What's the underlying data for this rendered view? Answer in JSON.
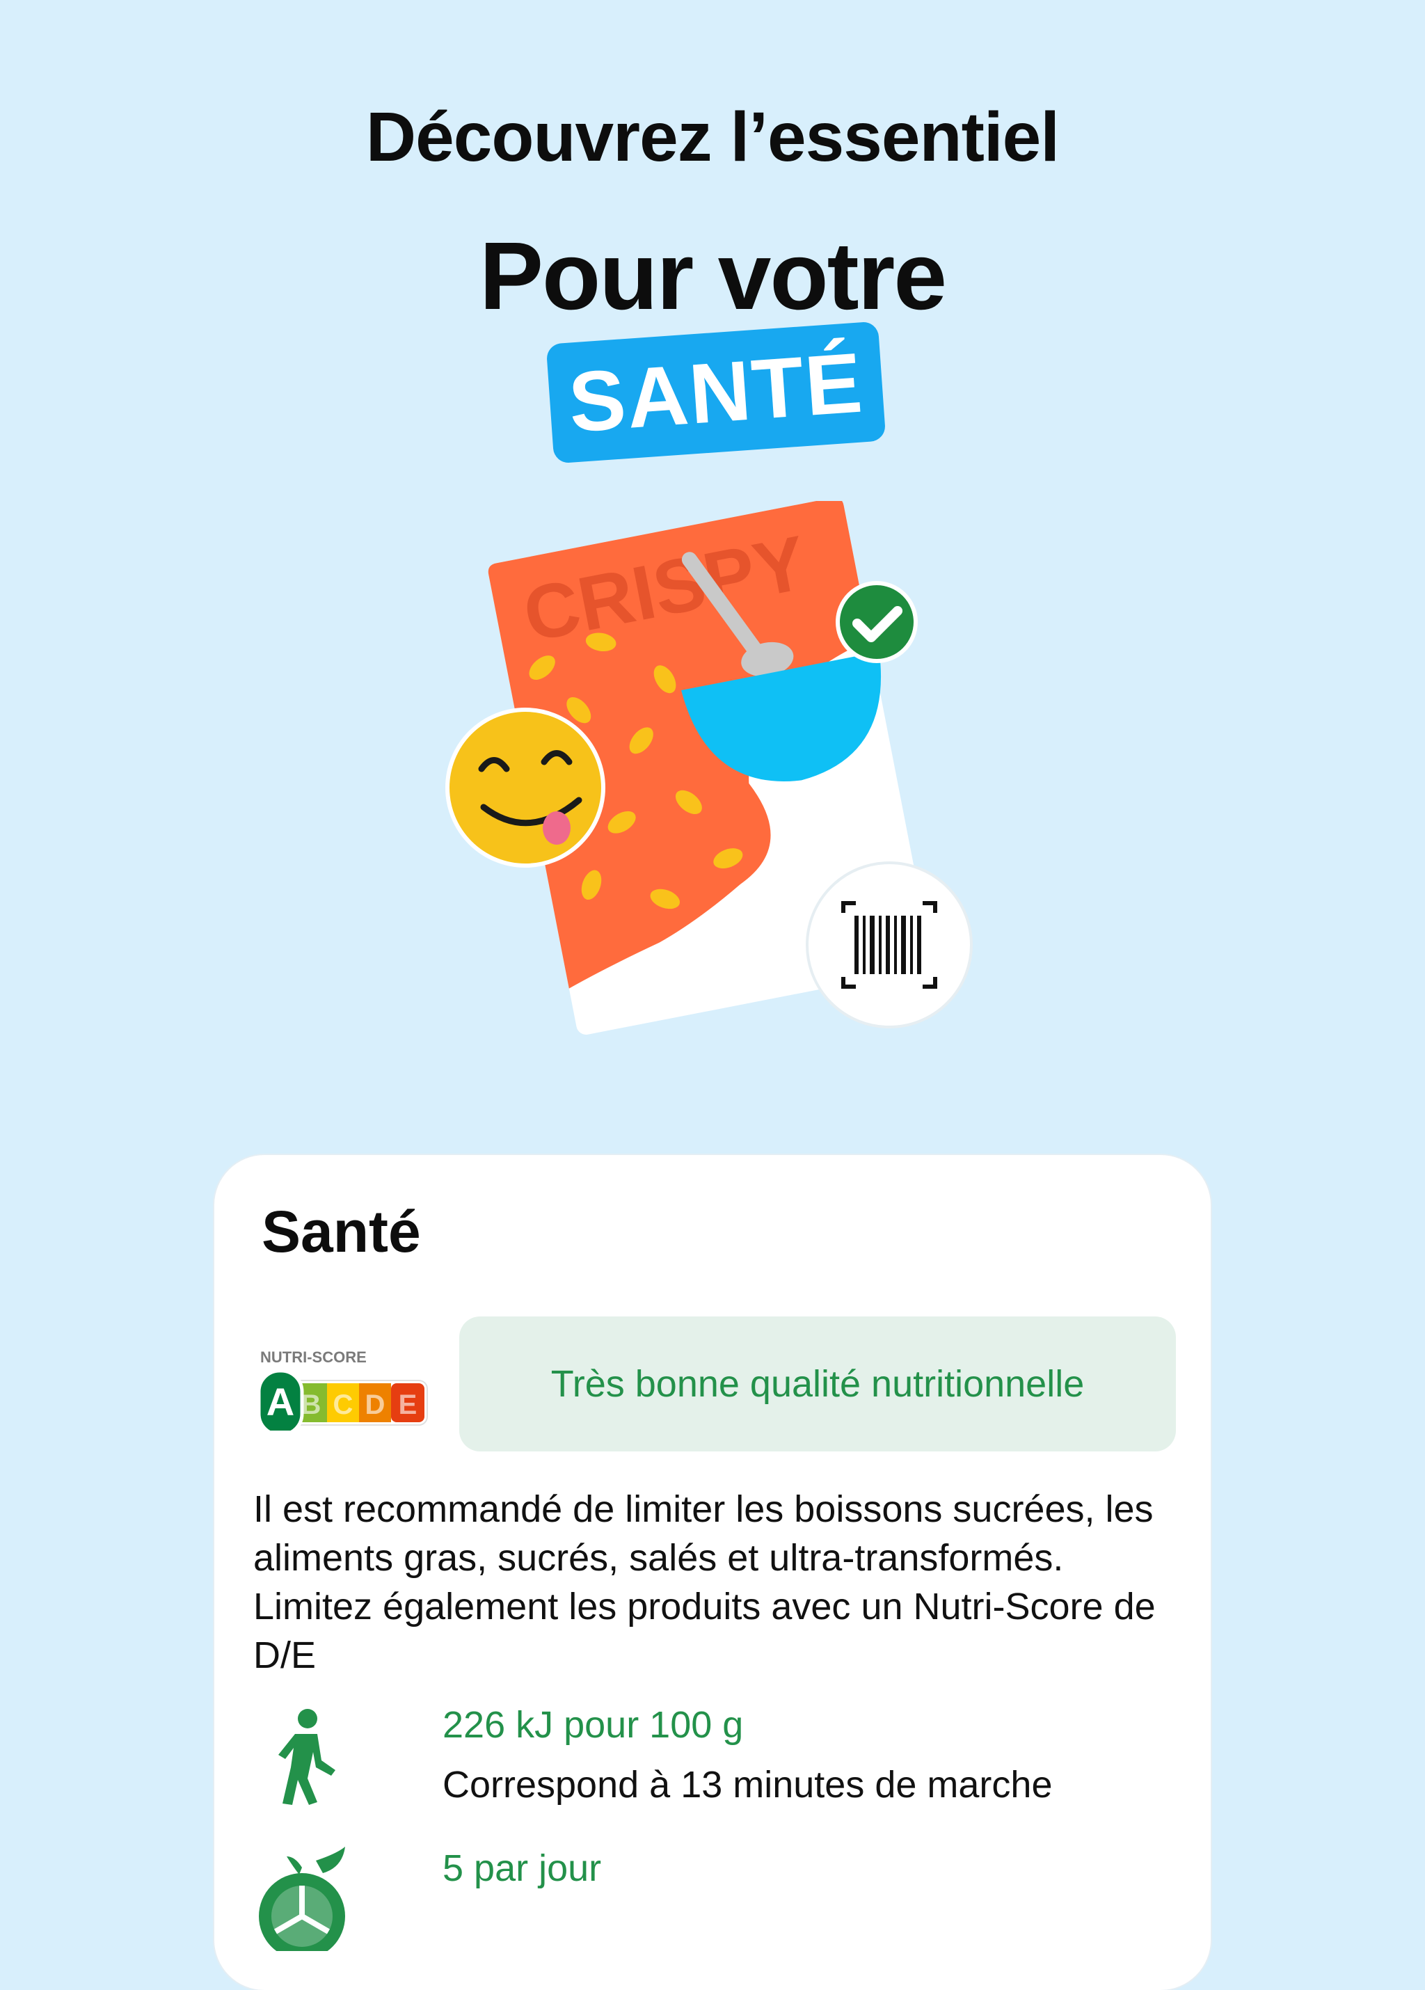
{
  "header": {
    "line1": "Découvrez l’essentiel",
    "line2": "Pour votre",
    "badge": "SANTÉ"
  },
  "illustration": {
    "package_label": "CRISPY",
    "icons": [
      "check-icon",
      "smiley-icon",
      "barcode-icon",
      "spoon-icon",
      "bowl-icon"
    ]
  },
  "card": {
    "title": "Santé",
    "nutri_score": {
      "label": "NUTRI-SCORE",
      "grades": [
        "A",
        "B",
        "C",
        "D",
        "E"
      ],
      "selected": "A"
    },
    "quality": "Très bonne qualité nutritionnelle",
    "recommendation": "Il est recommandé de limiter les boissons sucrées, les aliments gras, sucrés, salés et ultra-transformés. Limitez également les produits avec un Nutri-Score de D/E",
    "items": [
      {
        "icon": "walking-person-icon",
        "title": "226 kJ pour 100 g",
        "sub": "Correspond à 13 minutes de marche"
      },
      {
        "icon": "fruit-icon",
        "title": "5 par jour",
        "sub": ""
      }
    ]
  },
  "colors": {
    "background": "#d8effc",
    "badge": "#18a8f0",
    "green": "#23914a",
    "quality_bg": "#e4f1ea"
  }
}
